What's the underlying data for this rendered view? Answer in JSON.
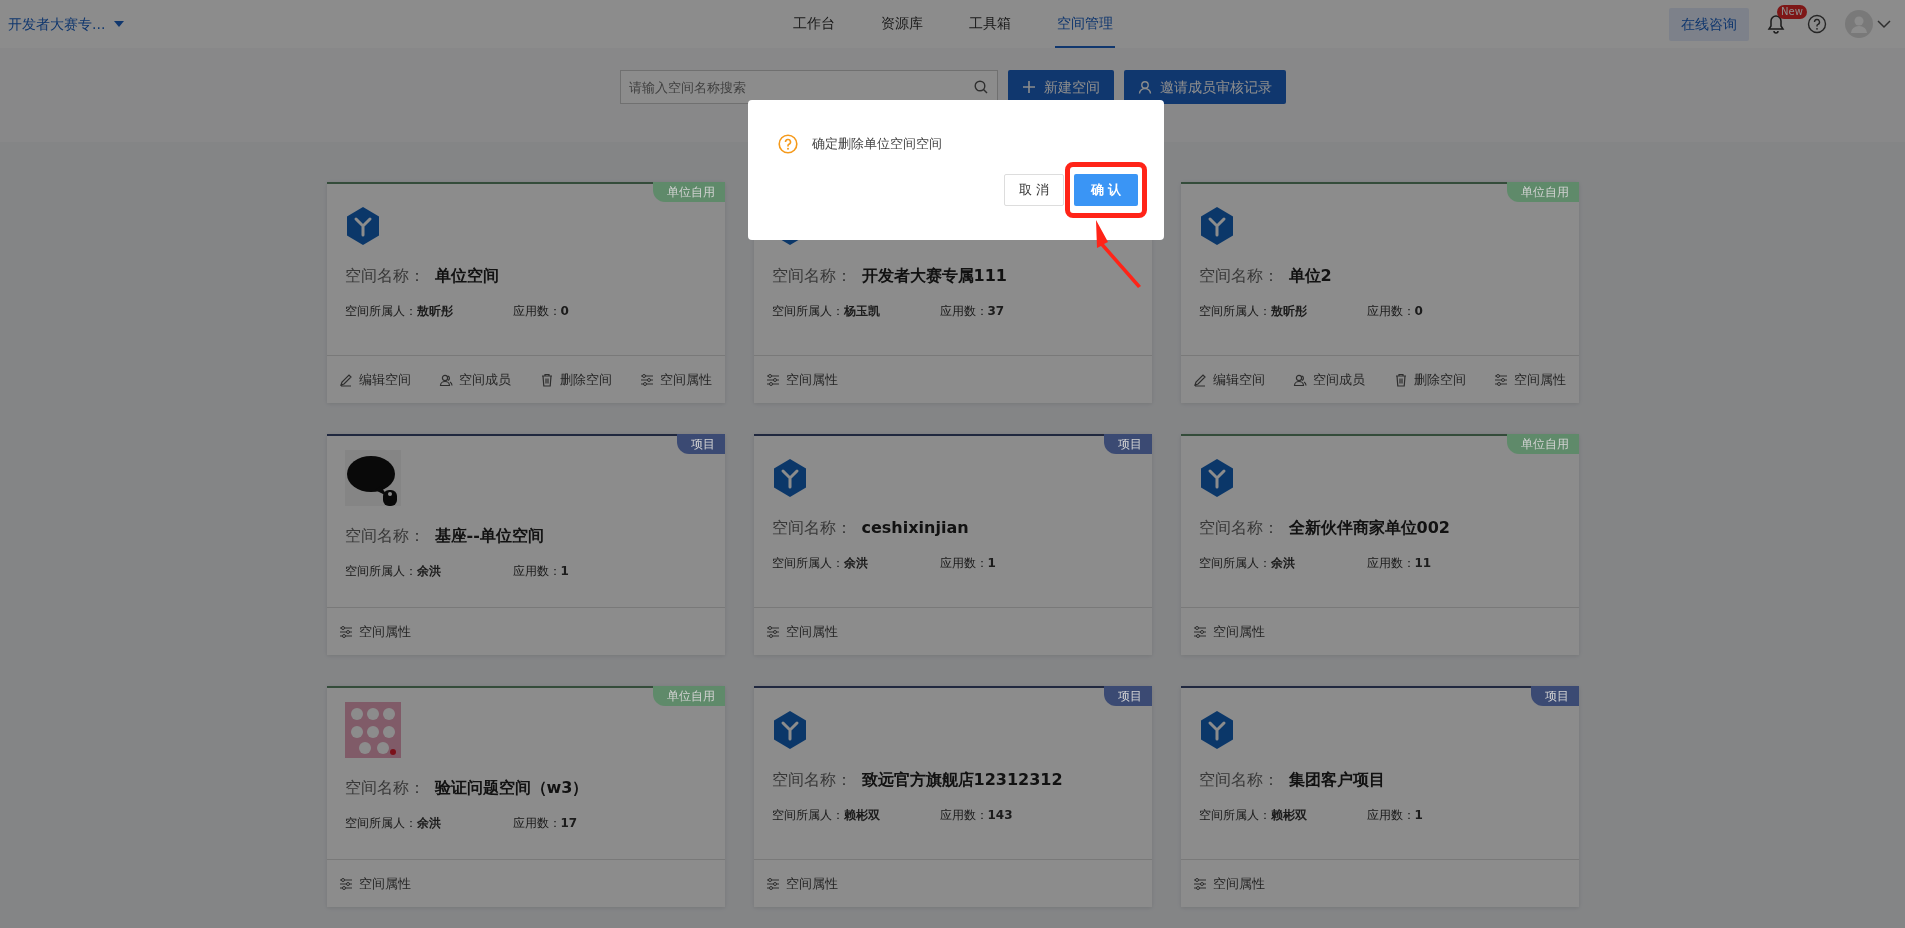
{
  "header": {
    "space_switcher": "开发者大赛专...",
    "tabs": [
      {
        "label": "工作台",
        "selected": false
      },
      {
        "label": "资源库",
        "selected": false
      },
      {
        "label": "工具箱",
        "selected": false
      },
      {
        "label": "空间管理",
        "selected": true
      }
    ],
    "consult_button": "在线咨询",
    "notification_badge": "New"
  },
  "toolbar": {
    "search": {
      "placeholder": "请输入空间名称搜索"
    },
    "buttons": [
      {
        "label": "新建空间",
        "kind": "plus"
      },
      {
        "label": "邀请成员审核记录",
        "kind": "person"
      }
    ]
  },
  "space_rows": [
    {
      "spaces": [
        {
          "tag": "单位自用",
          "color": "#5f8a6a",
          "kind": "logo",
          "name_label": "空间名称：",
          "name": "单位空间",
          "owner_label": "空间所属人：",
          "owner": "敖昕彤",
          "apps_label": "应用数：",
          "apps": "0",
          "actions": [
            {
              "label": "编辑空间",
              "kind": "edit"
            },
            {
              "label": "空间成员",
              "kind": "members"
            },
            {
              "label": "删除空间",
              "kind": "delete"
            },
            {
              "label": "空间属性",
              "kind": "props"
            }
          ]
        },
        {
          "kind": "logo",
          "name_label": "空间名称：",
          "name": "开发者大赛专属111",
          "owner_label": "空间所属人：",
          "owner": "杨玉凯",
          "apps_label": "应用数：",
          "apps": "37",
          "actions": [
            {
              "label": "空间属性",
              "kind": "props"
            }
          ]
        },
        {
          "tag": "单位自用",
          "color": "#5f8a6a",
          "kind": "logo",
          "name_label": "空间名称：",
          "name": "单位2",
          "owner_label": "空间所属人：",
          "owner": "敖昕彤",
          "apps_label": "应用数：",
          "apps": "0",
          "actions": [
            {
              "label": "编辑空间",
              "kind": "edit"
            },
            {
              "label": "空间成员",
              "kind": "members"
            },
            {
              "label": "删除空间",
              "kind": "delete"
            },
            {
              "label": "空间属性",
              "kind": "props"
            }
          ]
        }
      ]
    },
    {
      "spaces": [
        {
          "tag": "项目",
          "color": "#3b4a73",
          "kind": "picture",
          "name_label": "空间名称：",
          "name": "基座--单位空间",
          "owner_label": "空间所属人：",
          "owner": "余洪",
          "apps_label": "应用数：",
          "apps": "1",
          "actions": [
            {
              "label": "空间属性",
              "kind": "props"
            }
          ]
        },
        {
          "tag": "项目",
          "color": "#3b4a73",
          "kind": "logo",
          "name_label": "空间名称：",
          "name": "ceshixinjian",
          "owner_label": "空间所属人：",
          "owner": "余洪",
          "apps_label": "应用数：",
          "apps": "1",
          "actions": [
            {
              "label": "空间属性",
              "kind": "props"
            }
          ]
        },
        {
          "tag": "单位自用",
          "color": "#5f8a6a",
          "kind": "logo",
          "name_label": "空间名称：",
          "name": "全新伙伴商家单位002",
          "owner_label": "空间所属人：",
          "owner": "余洪",
          "apps_label": "应用数：",
          "apps": "11",
          "actions": [
            {
              "label": "空间属性",
              "kind": "props"
            }
          ]
        }
      ]
    },
    {
      "spaces": [
        {
          "tag": "单位自用",
          "color": "#5f8a6a",
          "kind": "picture",
          "name_label": "空间名称：",
          "name": "验证问题空间（w3）",
          "owner_label": "空间所属人：",
          "owner": "余洪",
          "apps_label": "应用数：",
          "apps": "17",
          "actions": [
            {
              "label": "空间属性",
              "kind": "props"
            }
          ]
        },
        {
          "tag": "项目",
          "color": "#3b4a73",
          "kind": "logo",
          "name_label": "空间名称：",
          "name": "致远官方旗舰店12312312",
          "owner_label": "空间所属人：",
          "owner": "赖彬双",
          "apps_label": "应用数：",
          "apps": "143",
          "actions": [
            {
              "label": "空间属性",
              "kind": "props"
            }
          ]
        },
        {
          "tag": "项目",
          "color": "#3b4a73",
          "kind": "logo",
          "name_label": "空间名称：",
          "name": "集团客户项目",
          "owner_label": "空间所属人：",
          "owner": "赖彬双",
          "apps_label": "应用数：",
          "apps": "1",
          "actions": [
            {
              "label": "空间属性",
              "kind": "props"
            }
          ]
        }
      ]
    }
  ],
  "dialog": {
    "message": "确定删除单位空间空间",
    "buttons": [
      {
        "label": "取 消",
        "kind": "cancel",
        "highlighted": false
      },
      {
        "label": "确 认",
        "kind": "confirm",
        "highlighted": true
      }
    ]
  }
}
